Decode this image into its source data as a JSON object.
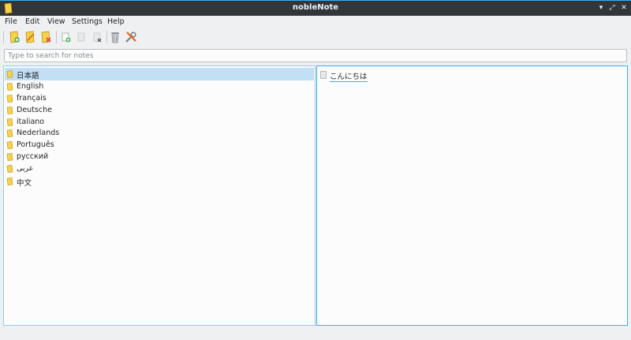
{
  "window": {
    "title": "nobleNote",
    "icon": "notebook-icon"
  },
  "menu": [
    "File",
    "Edit",
    "View",
    "Settings",
    "Help"
  ],
  "toolbar": {
    "buttons": [
      {
        "name": "new-folder-button",
        "icon": "new-folder-icon"
      },
      {
        "name": "rename-folder-button",
        "icon": "rename-folder-icon"
      },
      {
        "name": "delete-folder-button",
        "icon": "delete-folder-icon"
      },
      {
        "name": "new-note-button",
        "icon": "new-note-icon"
      },
      {
        "name": "rename-note-button",
        "icon": "rename-note-icon"
      },
      {
        "name": "delete-note-button",
        "icon": "delete-note-icon"
      },
      {
        "name": "trash-button",
        "icon": "trash-icon"
      },
      {
        "name": "preferences-button",
        "icon": "tools-icon"
      }
    ]
  },
  "search": {
    "placeholder": "Type to search for notes",
    "value": ""
  },
  "folders": {
    "selected_index": 0,
    "items": [
      "日本語",
      "English",
      "français",
      "Deutsche",
      "italiano",
      "Nederlands",
      "Português",
      "русский",
      "عربى",
      "中文"
    ]
  },
  "notes": {
    "items": [
      "こんにちは"
    ]
  },
  "colors": {
    "accent": "#3daee9",
    "folder": "#f5d24a",
    "selection": "#c2e0f5",
    "titlebar": "#31363b"
  }
}
